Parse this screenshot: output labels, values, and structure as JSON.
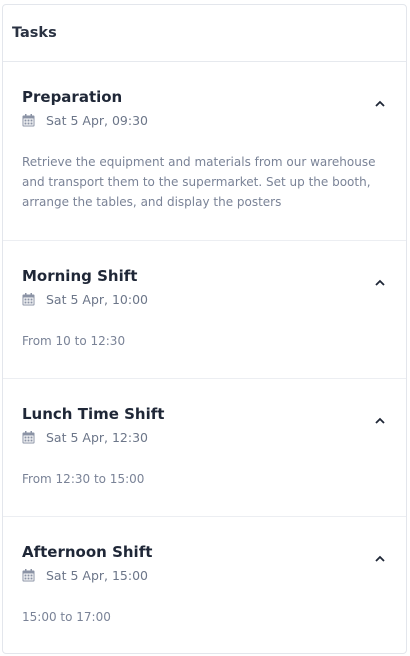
{
  "header": {
    "title": "Tasks"
  },
  "tasks": [
    {
      "title": "Preparation",
      "date": "Sat 5 Apr, 09:30",
      "description": "Retrieve the equipment and materials from our warehouse and transport them to the supermarket. Set up the booth, arrange the tables, and display the posters"
    },
    {
      "title": "Morning Shift",
      "date": "Sat 5 Apr, 10:00",
      "description": "From 10 to 12:30"
    },
    {
      "title": "Lunch Time Shift",
      "date": "Sat 5 Apr, 12:30",
      "description": "From 12:30 to 15:00"
    },
    {
      "title": "Afternoon Shift",
      "date": "Sat 5 Apr, 15:00",
      "description": "15:00 to 17:00"
    }
  ],
  "icons": {
    "date": "calendar-icon",
    "toggle": "chevron-up-icon"
  },
  "colors": {
    "text": "#1f2737",
    "muted": "#7a8397",
    "border": "#e3e6ec"
  }
}
